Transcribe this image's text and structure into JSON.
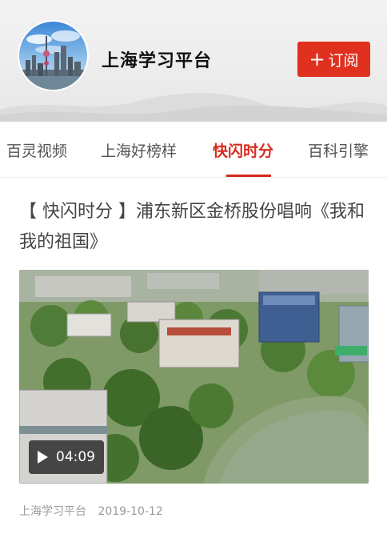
{
  "header": {
    "channel_name": "上海学习平台",
    "subscribe_label": "订阅",
    "subscribe_icon": "plus-icon"
  },
  "tabs": [
    {
      "label": "百灵视频",
      "active": false
    },
    {
      "label": "上海好榜样",
      "active": false
    },
    {
      "label": "快闪时分",
      "active": true
    },
    {
      "label": "百科引擎",
      "active": false
    }
  ],
  "article": {
    "title": "【 快闪时分 】浦东新区金桥股份唱响《我和我的祖国》",
    "duration": "04:09",
    "source": "上海学习平台",
    "date": "2019-10-12"
  },
  "colors": {
    "accent": "#d62a1e",
    "subscribe_bg": "#e0301e"
  }
}
